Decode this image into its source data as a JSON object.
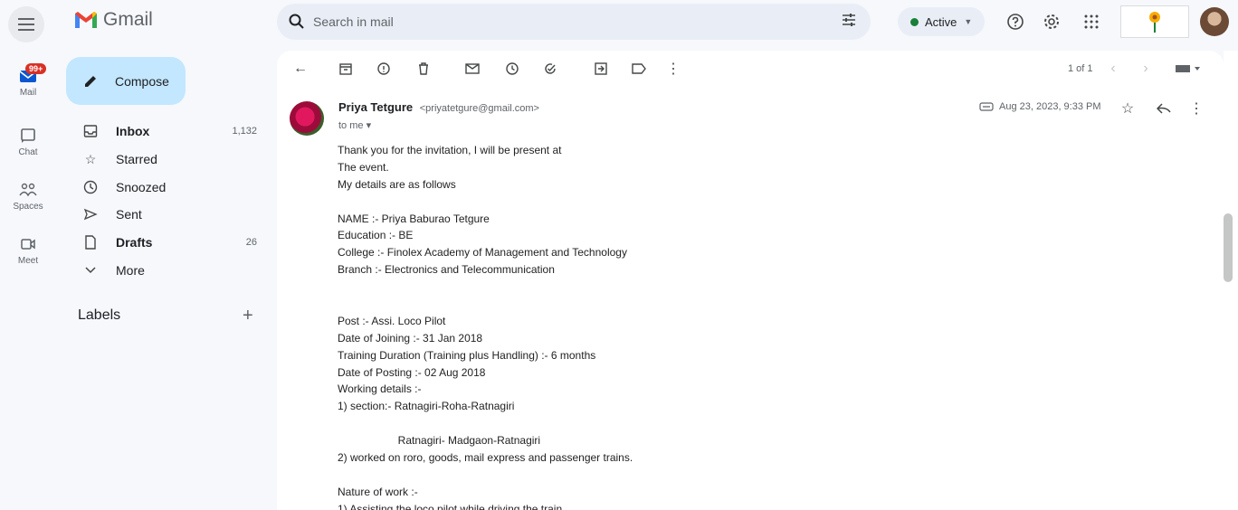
{
  "app": {
    "name": "Gmail"
  },
  "rail": {
    "mail_label": "Mail",
    "mail_badge": "99+",
    "chat_label": "Chat",
    "spaces_label": "Spaces",
    "meet_label": "Meet"
  },
  "nav": {
    "compose_label": "Compose",
    "items": [
      {
        "label": "Inbox",
        "count": "1,132"
      },
      {
        "label": "Starred",
        "count": ""
      },
      {
        "label": "Snoozed",
        "count": ""
      },
      {
        "label": "Sent",
        "count": ""
      },
      {
        "label": "Drafts",
        "count": "26"
      },
      {
        "label": "More",
        "count": ""
      }
    ],
    "labels_heading": "Labels"
  },
  "search": {
    "placeholder": "Search in mail"
  },
  "status": {
    "label": "Active",
    "color": "#188038"
  },
  "toolbar": {
    "pager": "1 of 1"
  },
  "email": {
    "sender_name": "Priya Tetgure",
    "sender_email": "<priyatetgure@gmail.com>",
    "to": "to me",
    "date": "Aug 23, 2023, 9:33 PM",
    "lines": [
      "Thank you for the invitation, I will be present at",
      "The event.",
      "My details are as follows",
      "",
      "NAME :- Priya Baburao Tetgure",
      "Education :- BE",
      "College :- Finolex Academy of Management and Technology",
      "Branch :- Electronics and Telecommunication",
      "",
      "",
      "Post :- Assi. Loco Pilot",
      "Date of Joining :- 31 Jan 2018",
      "Training Duration (Training plus Handling) :- 6 months",
      "Date of Posting :- 02 Aug 2018",
      "Working details :-",
      "1) section:- Ratnagiri-Roha-Ratnagiri",
      "",
      "                    Ratnagiri- Madgaon-Ratnagiri",
      "2) worked on roro, goods, mail express and passenger trains.",
      "",
      "Nature of work :-",
      "1) Assisting the loco pilot while driving the train."
    ]
  },
  "colors": {
    "accent": "#c2e7ff",
    "badge": "#d93025"
  }
}
